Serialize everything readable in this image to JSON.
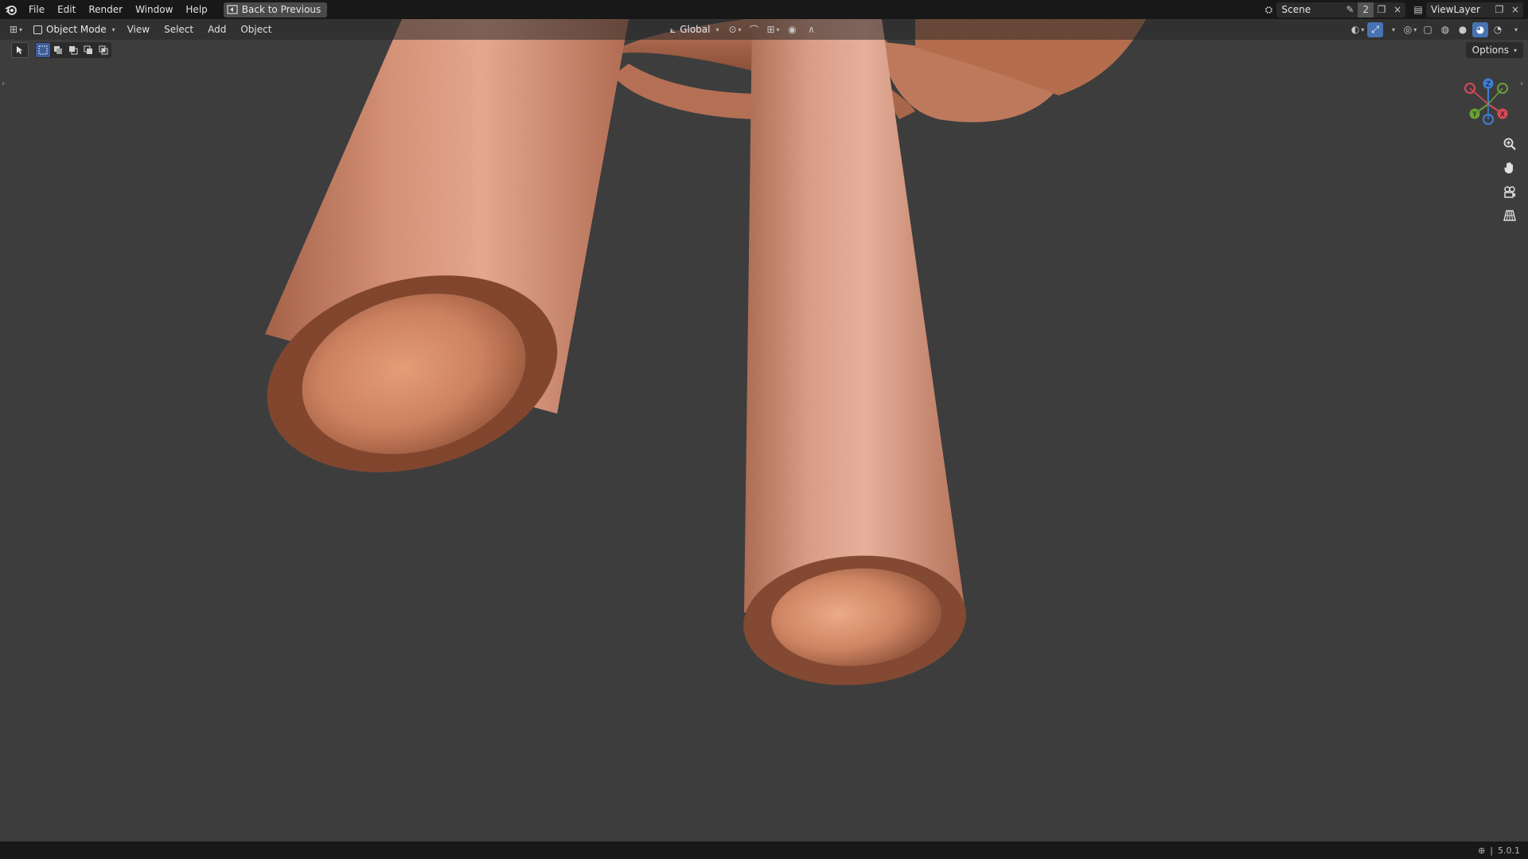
{
  "menubar": {
    "items": [
      "File",
      "Edit",
      "Render",
      "Window",
      "Help"
    ],
    "back_button": "Back to Previous"
  },
  "scene": {
    "name": "Scene",
    "count": "2"
  },
  "view_layer": {
    "name": "ViewLayer"
  },
  "viewport_header": {
    "mode": "Object Mode",
    "menus": [
      "View",
      "Select",
      "Add",
      "Object"
    ],
    "transform_orientation": "Global"
  },
  "options_label": "Options",
  "gizmo_axes": {
    "z": "Z",
    "y": "Y",
    "x": "X"
  },
  "status": {
    "version": "5.0.1"
  },
  "colors": {
    "accent": "#4772b3",
    "copper": "#d48a6a",
    "viewport_bg": "#3d3d3d"
  }
}
